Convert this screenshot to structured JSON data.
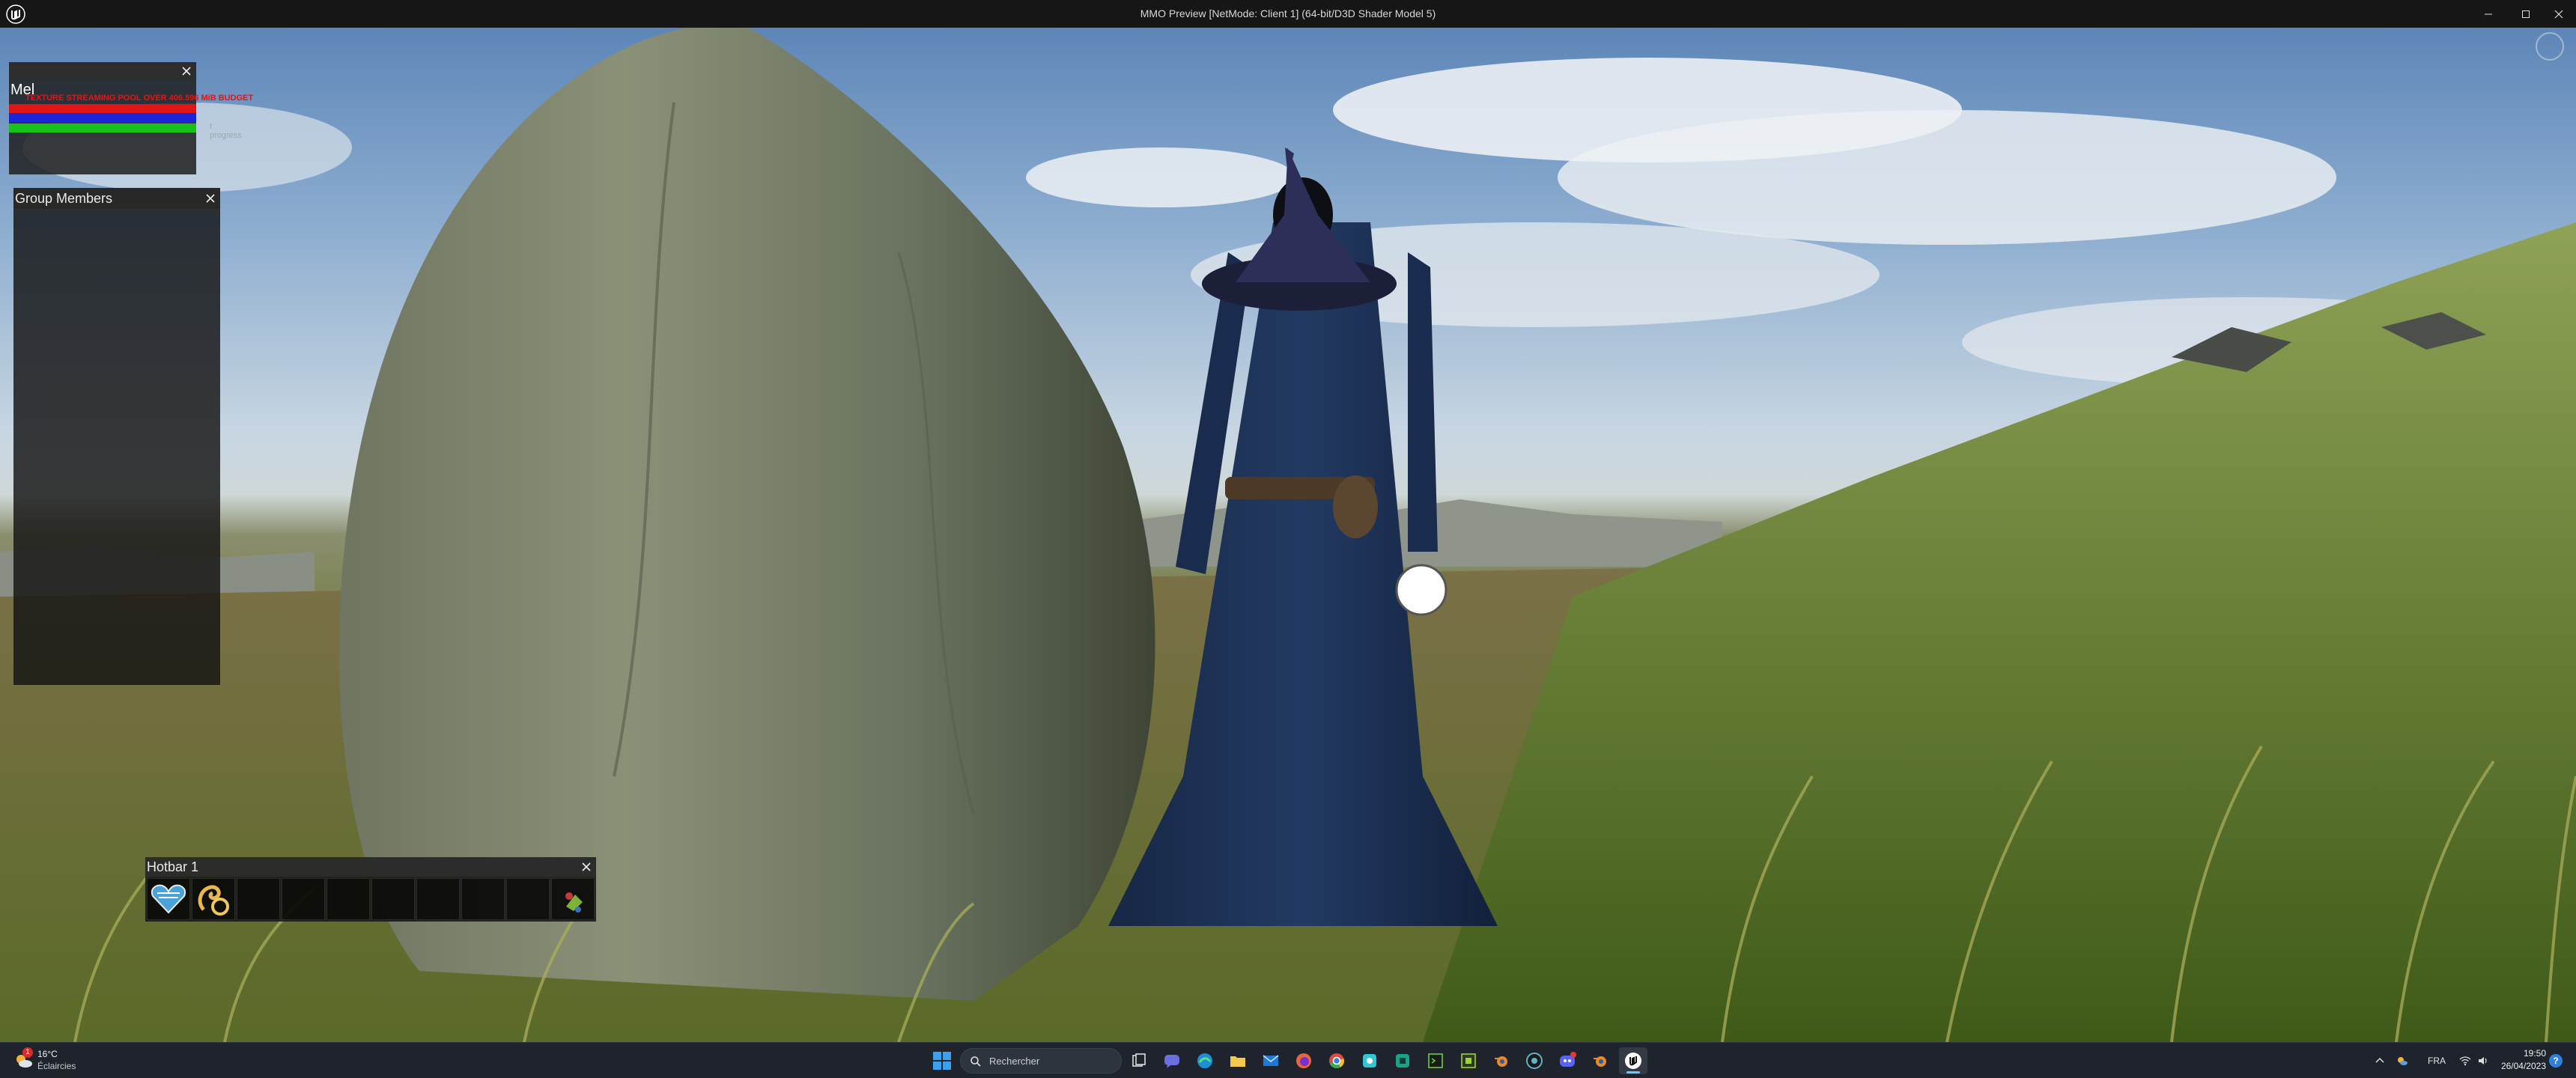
{
  "window": {
    "title": "MMO Preview [NetMode: Client 1]  (64-bit/D3D Shader Model 5)",
    "icons": {
      "logo": "unreal-engine-icon",
      "minimize": "minimize-icon",
      "maximize": "maximize-icon",
      "close": "close-icon"
    }
  },
  "hud": {
    "stats_panel": {
      "name": "Mel",
      "warning": "TEXTURE STREAMING POOL OVER 406.596 MiB BUDGET",
      "bars": [
        {
          "color": "#e01515",
          "fill": 1.0
        },
        {
          "color": "#1b24d6",
          "fill": 1.0
        },
        {
          "color": "#17c21a",
          "fill": 1.0
        }
      ],
      "extra_text": "t progress",
      "close_icon": "close-icon"
    },
    "group_panel": {
      "title": "Group Members",
      "close_icon": "close-icon"
    },
    "hotbar": {
      "title": "Hotbar 1",
      "close_icon": "close-icon",
      "slots": [
        "heart-gem-icon",
        "fire-swirl-icon",
        "",
        "",
        "",
        "",
        "",
        "",
        "",
        "gem-bag-icon"
      ]
    }
  },
  "taskbar": {
    "weather": {
      "temp": "16°C",
      "condition": "Éclaircies",
      "badge": "1",
      "icon": "sun-cloud-icon"
    },
    "search_placeholder": "Rechercher",
    "apps": [
      {
        "name": "task-view",
        "icon": "task-view-icon"
      },
      {
        "name": "teams-chat",
        "icon": "chat-icon"
      },
      {
        "name": "edge",
        "icon": "edge-icon"
      },
      {
        "name": "file-explorer",
        "icon": "folder-icon"
      },
      {
        "name": "mail",
        "icon": "mail-icon"
      },
      {
        "name": "firefox",
        "icon": "firefox-icon"
      },
      {
        "name": "chrome",
        "icon": "chrome-icon"
      },
      {
        "name": "app-cyan",
        "icon": "cyan-app-icon"
      },
      {
        "name": "app-teal",
        "icon": "teal-app-icon"
      },
      {
        "name": "app-green-terminal",
        "icon": "terminal-icon"
      },
      {
        "name": "app-green-square",
        "icon": "green-app-icon"
      },
      {
        "name": "blender",
        "icon": "blender-icon"
      },
      {
        "name": "app-circle",
        "icon": "circle-app-icon"
      },
      {
        "name": "discord",
        "icon": "discord-icon",
        "badge": "2"
      },
      {
        "name": "blender-2",
        "icon": "blender-icon"
      },
      {
        "name": "unreal-engine",
        "icon": "unreal-engine-icon",
        "active": true
      }
    ],
    "tray": {
      "language": "FRA",
      "icons": [
        "chevron-up-icon",
        "weather-tray-icon",
        "wifi-icon",
        "volume-icon"
      ]
    },
    "clock": {
      "time": "19:50",
      "date": "26/04/2023"
    },
    "help_label": "?"
  }
}
